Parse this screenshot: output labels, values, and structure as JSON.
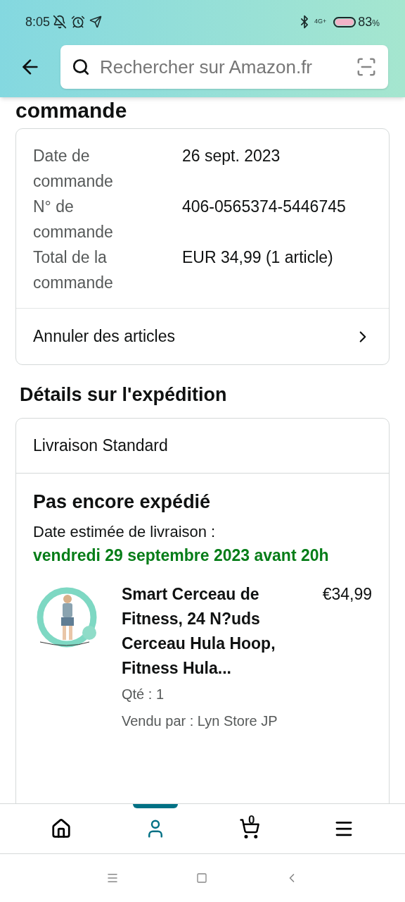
{
  "status_bar": {
    "time": "8:05",
    "network": "4G+",
    "battery": "83",
    "battery_unit": "%"
  },
  "search": {
    "placeholder": "Rechercher sur Amazon.fr"
  },
  "page_heading": "commande",
  "order_info": {
    "rows": [
      {
        "label": "Date de commande",
        "value": "26 sept. 2023"
      },
      {
        "label": "N° de commande",
        "value": "406-0565374-5446745"
      },
      {
        "label": "Total de la commande",
        "value": "EUR 34,99 (1 article)"
      }
    ],
    "action": "Annuler des articles"
  },
  "shipping": {
    "title": "Détails sur l'expédition",
    "method": "Livraison Standard",
    "status": "Pas encore expédié",
    "estimate_label": "Date estimée de livraison :",
    "estimate_date": "vendredi 29 septembre 2023 avant 20h",
    "item": {
      "kind": "picture",
      "title": "Smart Cerceau de Fitness, 24 N?uds Cerceau Hula Hoop, Fitness Hula...",
      "price": "€34,99",
      "quantity": "Qté : 1",
      "seller": "Vendu par : Lyn Store JP"
    }
  },
  "tab_bar": [
    {
      "kind": "home",
      "selected": false
    },
    {
      "kind": "account",
      "selected": true
    },
    {
      "kind": "cart",
      "selected": false,
      "count": "0"
    },
    {
      "kind": "menu",
      "selected": false
    }
  ]
}
